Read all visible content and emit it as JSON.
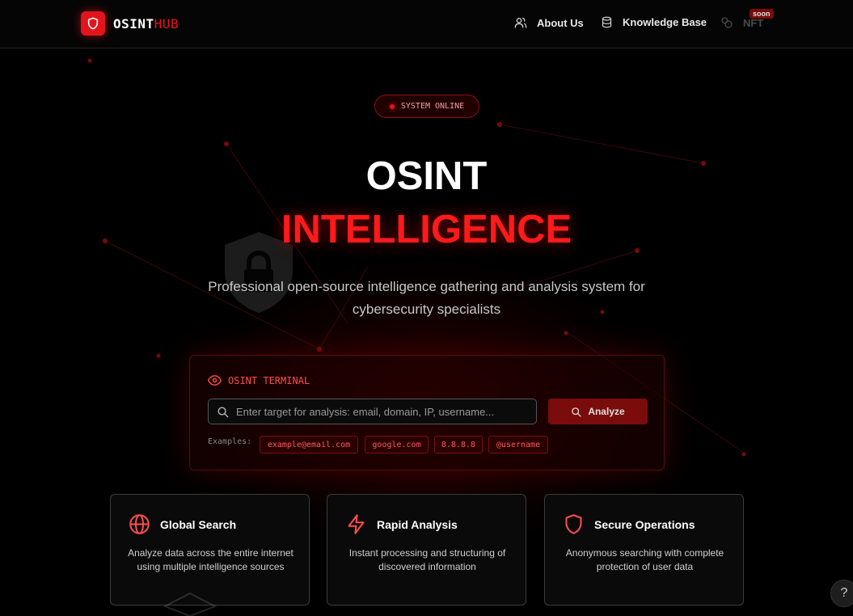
{
  "header": {
    "logo_text_white": "OSINT",
    "logo_text_red": "HUB",
    "nav": {
      "about": "About Us",
      "knowledge": "Knowledge Base",
      "nft": "NFT",
      "nft_badge": "soon"
    }
  },
  "hero": {
    "status": "SYSTEM ONLINE",
    "title_line1": "OSINT",
    "title_line2": "INTELLIGENCE",
    "subtitle": "Professional open-source intelligence gathering and analysis system for cybersecurity specialists"
  },
  "terminal": {
    "title": "OSINT TERMINAL",
    "placeholder": "Enter target for analysis: email, domain, IP, username...",
    "value": "",
    "button": "Analyze",
    "examples_label": "Examples:",
    "examples": [
      "example@email.com",
      "google.com",
      "8.8.8.8",
      "@username"
    ]
  },
  "features": [
    {
      "icon": "globe-icon",
      "title": "Global Search",
      "text": "Analyze data across the entire internet using multiple intelligence sources"
    },
    {
      "icon": "lightning-icon",
      "title": "Rapid Analysis",
      "text": "Instant processing and structuring of discovered information"
    },
    {
      "icon": "shield-icon",
      "title": "Secure Operations",
      "text": "Anonymous searching with complete protection of user data"
    }
  ],
  "help": "?",
  "colors": {
    "accent": "#e3141b",
    "background": "#000000",
    "muted_text": "#c8c8c8"
  }
}
